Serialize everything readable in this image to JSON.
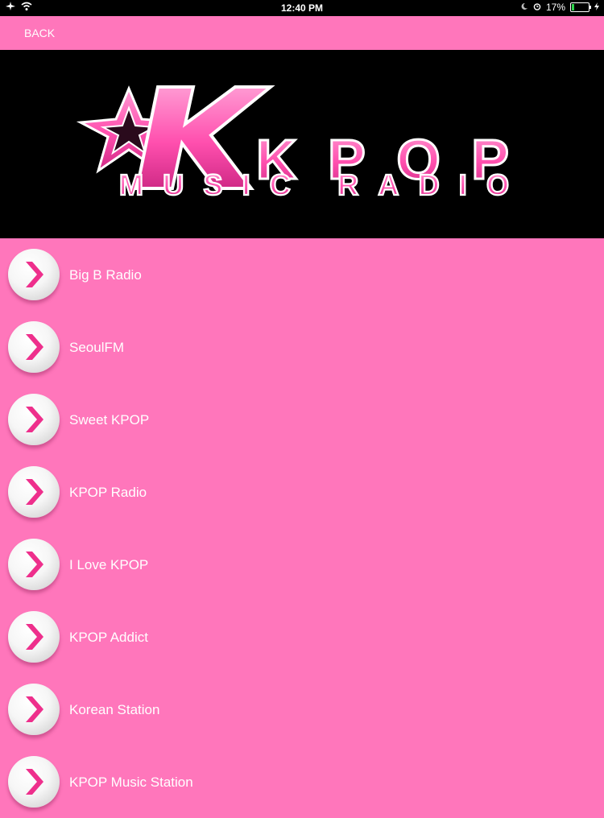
{
  "status_bar": {
    "time": "12:40 PM",
    "battery_percent": "17%",
    "battery_level": 0.17,
    "icons": [
      "airplane-icon",
      "wifi-icon",
      "moon-icon",
      "alarm-icon",
      "battery-icon"
    ]
  },
  "nav": {
    "back_label": "BACK"
  },
  "banner": {
    "logo_title": "KPOP",
    "logo_subtitle": "MUSIC RADIO",
    "colors": {
      "pink": "#ff5fb8",
      "outline": "#ffffff",
      "shadow": "#6b0b43"
    }
  },
  "stations": [
    {
      "label": "Big B Radio"
    },
    {
      "label": "SeoulFM"
    },
    {
      "label": "Sweet KPOP"
    },
    {
      "label": "KPOP Radio"
    },
    {
      "label": "I Love KPOP"
    },
    {
      "label": "KPOP Addict"
    },
    {
      "label": "Korean Station"
    },
    {
      "label": "KPOP Music Station"
    }
  ],
  "theme": {
    "background": "#ff76bb",
    "arrow_color": "#ee2f8c"
  }
}
